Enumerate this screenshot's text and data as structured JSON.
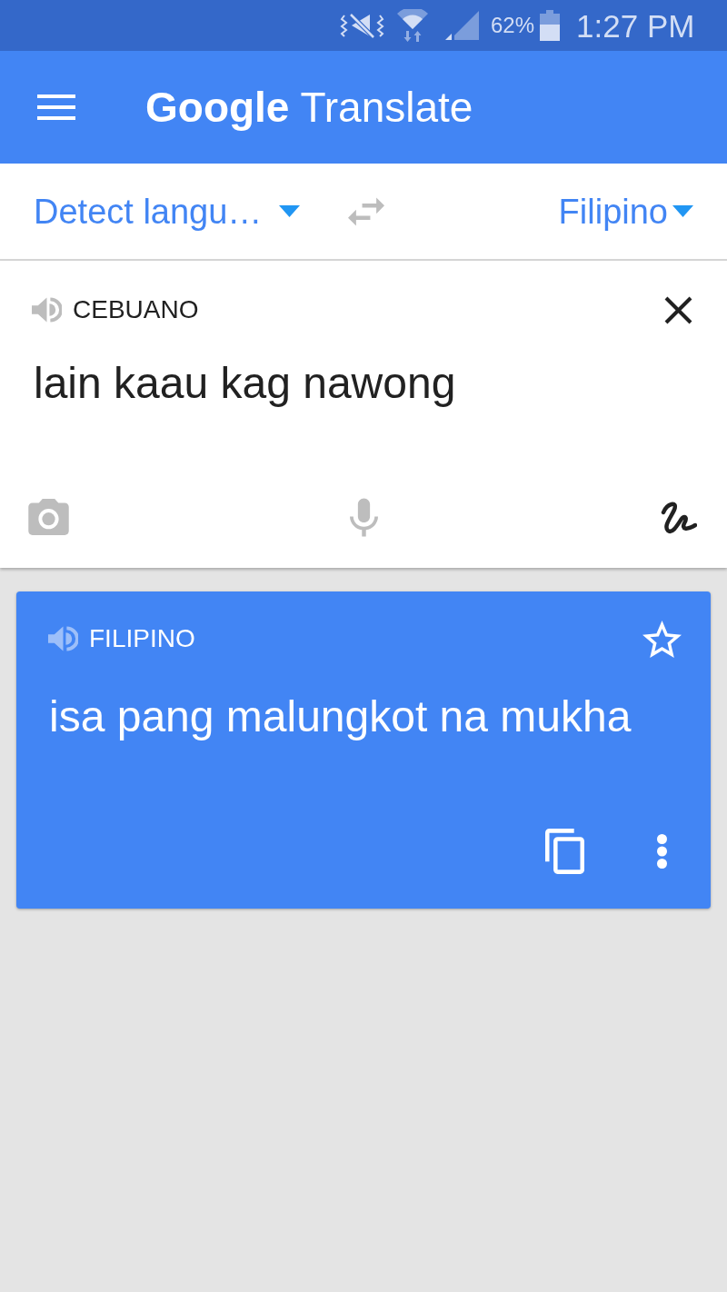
{
  "status_bar": {
    "battery_percent": "62%",
    "time": "1:27 PM"
  },
  "app_bar": {
    "title": "**Google** Translate"
  },
  "language_bar": {
    "source": "Detect langu…",
    "target": "Filipino"
  },
  "input_card": {
    "detected_language": "CEBUANO",
    "value": "lain kaau kag nawong"
  },
  "result_card": {
    "language": "FILIPINO",
    "translation": "isa pang malungkot na mukha",
    "starred": false
  }
}
